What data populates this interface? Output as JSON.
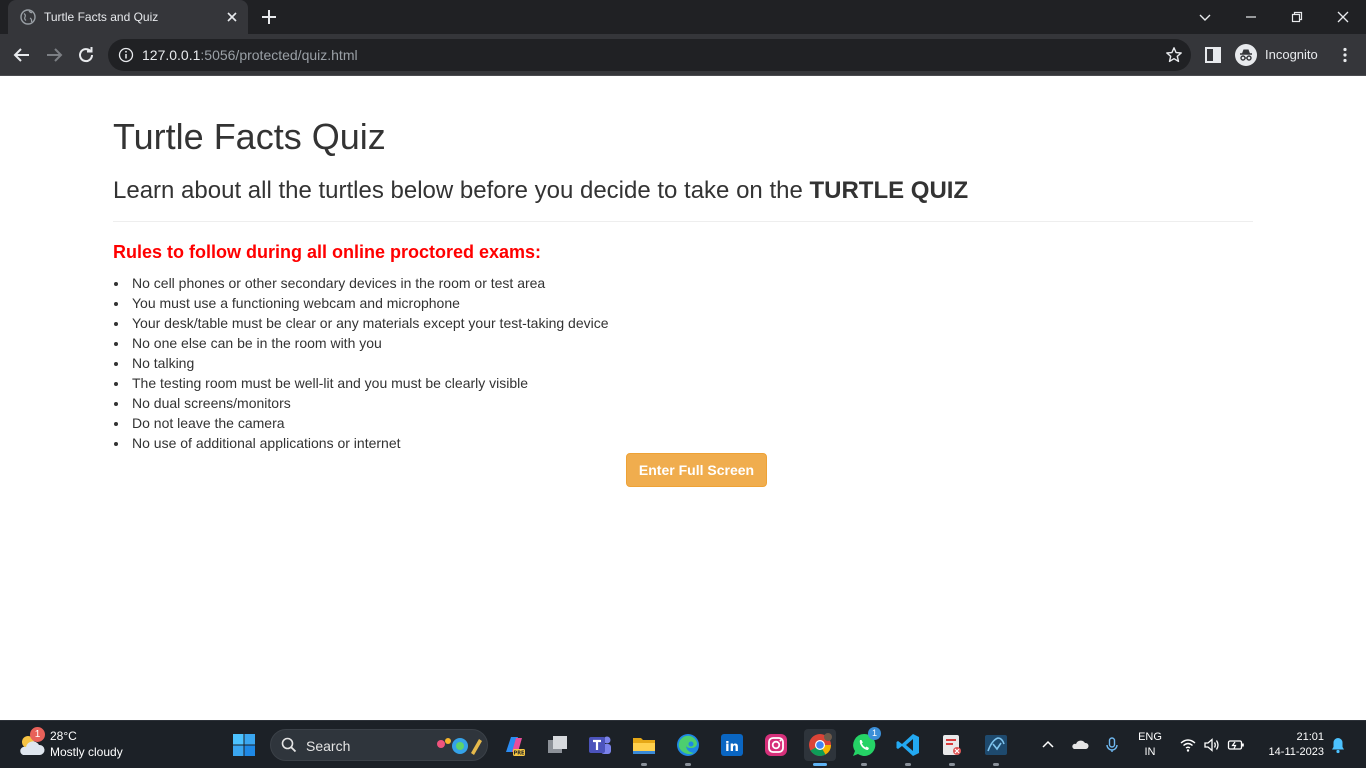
{
  "browser": {
    "tab_title": "Turtle Facts and Quiz",
    "url_host": "127.0.0.1",
    "url_rest": ":5056/protected/quiz.html",
    "profile_label": "Incognito"
  },
  "page": {
    "title": "Turtle Facts Quiz",
    "lead_prefix": "Learn about all the turtles below before you decide to take on the ",
    "lead_emphasis": "TURTLE QUIZ",
    "rules_heading": "Rules to follow during all online proctored exams:",
    "rules": [
      "No cell phones or other secondary devices in the room or test area",
      "You must use a functioning webcam and microphone",
      "Your desk/table must be clear or any materials except your test-taking device",
      "No one else can be in the room with you",
      "No talking",
      "The testing room must be well-lit and you must be clearly visible",
      "No dual screens/monitors",
      "Do not leave the camera",
      "No use of additional applications or internet"
    ],
    "fullscreen_button": "Enter Full Screen"
  },
  "taskbar": {
    "weather_badge": "1",
    "weather_temp": "28°C",
    "weather_desc": "Mostly cloudy",
    "search_label": "Search",
    "whatsapp_badge": "1",
    "lang_top": "ENG",
    "lang_bottom": "IN",
    "time": "21:01",
    "date": "14-11-2023",
    "apps": [
      "copilot-icon",
      "task-view-icon",
      "teams-icon",
      "file-explorer-icon",
      "edge-icon",
      "linkedin-icon",
      "instagram-icon",
      "chrome-icon",
      "whatsapp-icon",
      "vscode-icon",
      "snipping-tool-icon",
      "mysql-workbench-icon"
    ]
  },
  "colors": {
    "accent_button": "#f0ad4e",
    "rules_heading": "#ff0000",
    "chrome_dark": "#202124",
    "chrome_toolbar": "#35363a"
  }
}
